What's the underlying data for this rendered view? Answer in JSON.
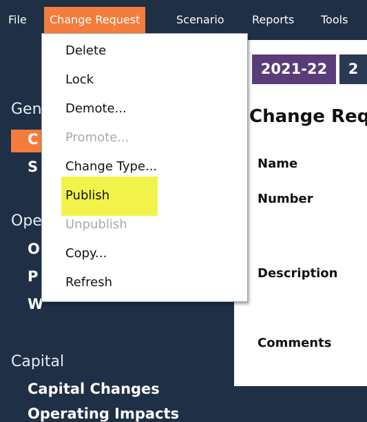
{
  "menubar": {
    "items": [
      {
        "label": "File"
      },
      {
        "label": "Change Request"
      },
      {
        "label": "Scenario"
      },
      {
        "label": "Reports"
      },
      {
        "label": "Tools"
      }
    ]
  },
  "sidebar": {
    "sections": [
      {
        "heading": "Gen",
        "items": [
          {
            "label": "C"
          },
          {
            "label": "S"
          }
        ]
      },
      {
        "heading": "Ope",
        "items": [
          {
            "label": "O"
          },
          {
            "label": "P"
          },
          {
            "label": "W"
          }
        ]
      },
      {
        "heading": "Capital",
        "items": [
          {
            "label": "Capital Changes"
          },
          {
            "label": "Operating Impacts"
          }
        ]
      }
    ]
  },
  "main": {
    "tabs": [
      {
        "label": "2021-22"
      },
      {
        "label": "2"
      }
    ],
    "title": "Change Req",
    "fields": [
      {
        "label": "Name"
      },
      {
        "label": "Number"
      },
      {
        "label": "Description"
      },
      {
        "label": "Comments"
      }
    ]
  },
  "dropdown": {
    "items": [
      {
        "label": "Delete",
        "enabled": true
      },
      {
        "label": "Lock",
        "enabled": true
      },
      {
        "label": "Demote...",
        "enabled": true
      },
      {
        "label": "Promote...",
        "enabled": false
      },
      {
        "label": "Change Type...",
        "enabled": true
      },
      {
        "label": "Publish",
        "enabled": true,
        "highlighted": true
      },
      {
        "label": "Unpublish",
        "enabled": false
      },
      {
        "label": "Copy...",
        "enabled": true
      },
      {
        "label": "Refresh",
        "enabled": true
      }
    ]
  },
  "colors": {
    "nav_bg": "#1f2f45",
    "accent": "#f47c3c",
    "tab_active": "#5a3d78",
    "highlight": "#f1f34b"
  }
}
